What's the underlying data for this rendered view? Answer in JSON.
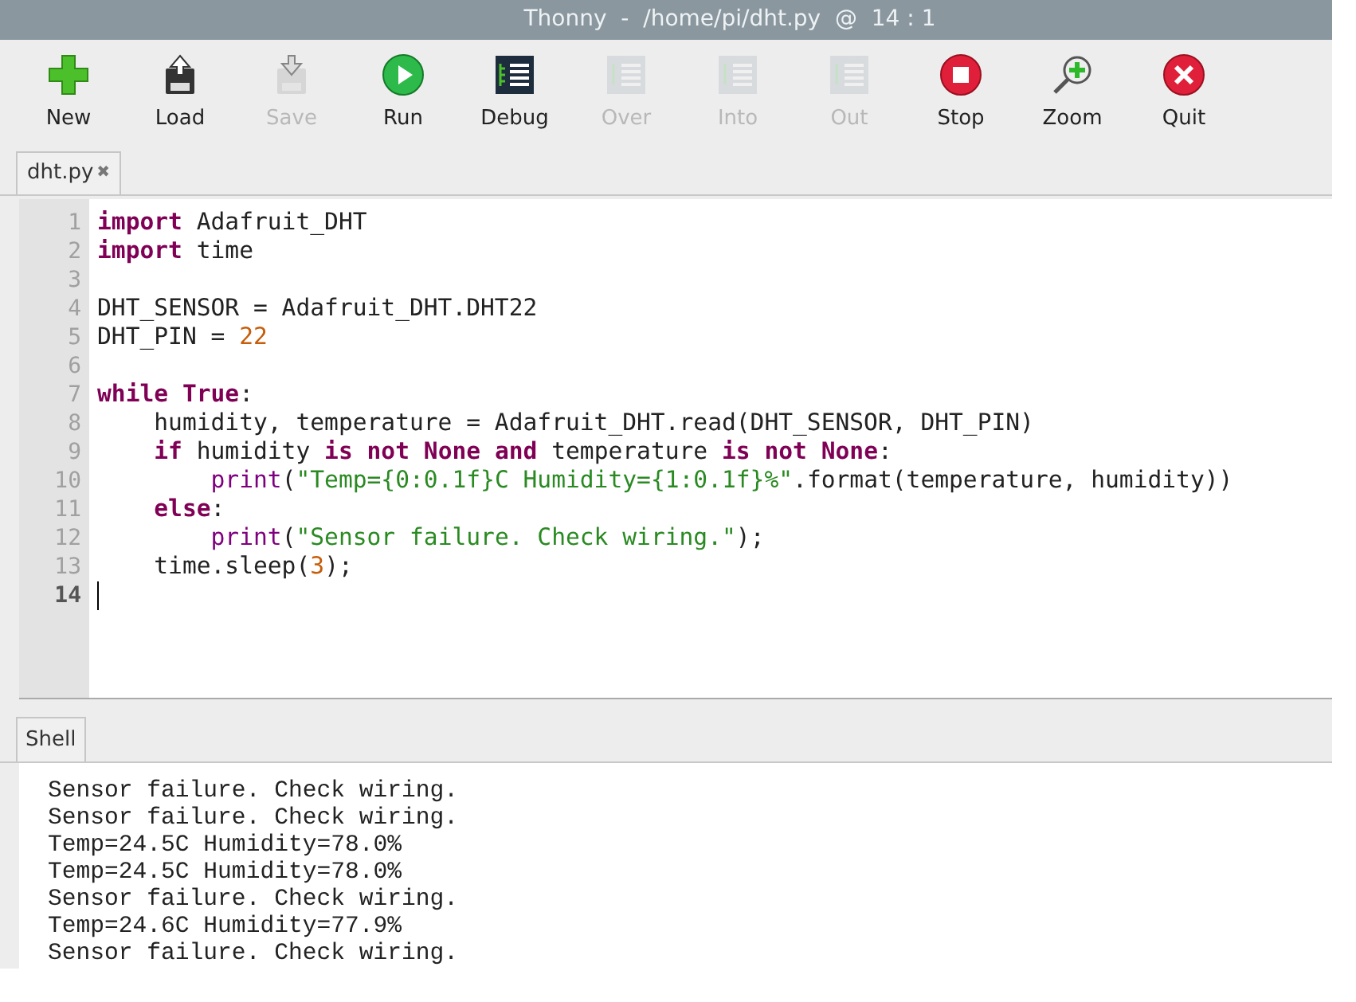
{
  "window": {
    "title": "Thonny  -  /home/pi/dht.py  @  14 : 1"
  },
  "toolbar": [
    {
      "label": "New",
      "disabled": false
    },
    {
      "label": "Load",
      "disabled": false
    },
    {
      "label": "Save",
      "disabled": true
    },
    {
      "label": "Run",
      "disabled": false
    },
    {
      "label": "Debug",
      "disabled": false
    },
    {
      "label": "Over",
      "disabled": true
    },
    {
      "label": "Into",
      "disabled": true
    },
    {
      "label": "Out",
      "disabled": true
    },
    {
      "label": "Stop",
      "disabled": false
    },
    {
      "label": "Zoom",
      "disabled": false
    },
    {
      "label": "Quit",
      "disabled": false
    }
  ],
  "editor_tabs": [
    {
      "label": "dht.py",
      "close": "✖",
      "selected": true
    }
  ],
  "editor": {
    "lines": [
      {
        "number": "1",
        "current": false,
        "tokens": [
          {
            "text": "import",
            "kind": "keyword"
          },
          {
            "text": " Adafruit_DHT",
            "kind": "plain"
          }
        ]
      },
      {
        "number": "2",
        "current": false,
        "tokens": [
          {
            "text": "import",
            "kind": "keyword"
          },
          {
            "text": " time",
            "kind": "plain"
          }
        ]
      },
      {
        "number": "3",
        "current": false
      },
      {
        "number": "4",
        "current": false,
        "tokens": [
          {
            "text": "DHT_SENSOR = Adafruit_DHT.DHT22",
            "kind": "plain"
          }
        ]
      },
      {
        "number": "5",
        "current": false,
        "tokens": [
          {
            "text": "DHT_PIN = ",
            "kind": "plain"
          },
          {
            "text": "22",
            "kind": "number"
          }
        ]
      },
      {
        "number": "6",
        "current": false
      },
      {
        "number": "7",
        "current": false,
        "tokens": [
          {
            "text": "while True",
            "kind": "keyword"
          },
          {
            "text": ":",
            "kind": "plain"
          }
        ]
      },
      {
        "number": "8",
        "current": false,
        "tokens": [
          {
            "text": "    humidity, temperature = Adafruit_DHT.read(DHT_SENSOR, DHT_PIN)",
            "kind": "plain"
          }
        ]
      },
      {
        "number": "9",
        "current": false,
        "tokens": [
          {
            "text": "    if",
            "kind": "keyword"
          },
          {
            "text": " humidity ",
            "kind": "plain"
          },
          {
            "text": "is not None and",
            "kind": "keyword"
          },
          {
            "text": " temperature ",
            "kind": "plain"
          },
          {
            "text": "is not None",
            "kind": "keyword"
          },
          {
            "text": ":",
            "kind": "plain"
          }
        ]
      },
      {
        "number": "10",
        "current": false,
        "tokens": [
          {
            "text": "        print",
            "kind": "builtin"
          },
          {
            "text": "(",
            "kind": "plain"
          },
          {
            "text": "\"Temp={0:0.1f}C Humidity={1:0.1f}%\"",
            "kind": "string"
          },
          {
            "text": ".format(temperature, humidity))",
            "kind": "plain"
          }
        ]
      },
      {
        "number": "11",
        "current": false,
        "tokens": [
          {
            "text": "    else",
            "kind": "keyword"
          },
          {
            "text": ":",
            "kind": "plain"
          }
        ]
      },
      {
        "number": "12",
        "current": false,
        "tokens": [
          {
            "text": "        print",
            "kind": "builtin"
          },
          {
            "text": "(",
            "kind": "plain"
          },
          {
            "text": "\"Sensor failure. Check wiring.\"",
            "kind": "string"
          },
          {
            "text": ");",
            "kind": "plain"
          }
        ]
      },
      {
        "number": "13",
        "current": false,
        "tokens": [
          {
            "text": "    time.sleep(",
            "kind": "plain"
          },
          {
            "text": "3",
            "kind": "number"
          },
          {
            "text": ");",
            "kind": "plain"
          }
        ]
      },
      {
        "number": "14",
        "current": true
      }
    ]
  },
  "shell": {
    "tab": {
      "label": "Shell",
      "selected": true
    },
    "output": [
      "Sensor failure. Check wiring.",
      "Sensor failure. Check wiring.",
      "Temp=24.5C Humidity=78.0%",
      "Temp=24.5C Humidity=78.0%",
      "Sensor failure. Check wiring.",
      "Temp=24.6C Humidity=77.9%",
      "Sensor failure. Check wiring."
    ]
  }
}
